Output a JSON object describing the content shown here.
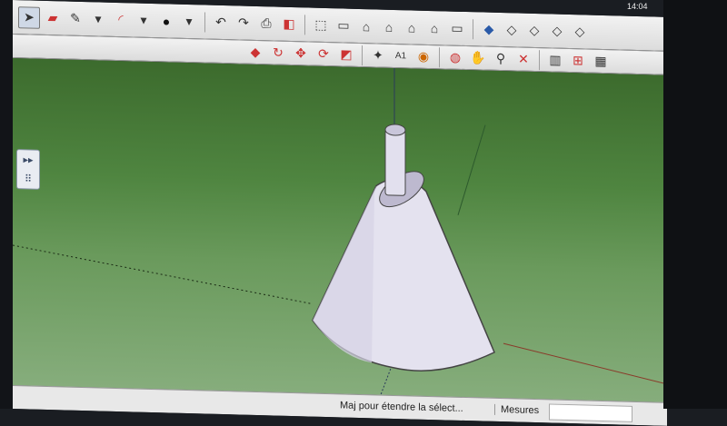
{
  "toolbar_row1": [
    "select-arrow-icon",
    "eraser-icon",
    "pencil-icon",
    "dropdown-icon",
    "arc-icon",
    "dropdown-icon",
    "circle-icon",
    "dropdown-icon",
    "undo-icon",
    "redo-icon",
    "print-icon",
    "model-info-icon",
    "iso-view-icon",
    "top-view-icon",
    "front-view-icon",
    "right-view-icon",
    "back-view-icon",
    "left-view-icon",
    "bottom-view-icon"
  ],
  "toolbar_row2": [
    "push-pull-icon",
    "follow-me-icon",
    "move-icon",
    "rotate-icon",
    "scale-icon",
    "tape-measure-icon",
    "text-icon",
    "paint-bucket-icon",
    "orbit-icon",
    "pan-icon",
    "zoom-icon",
    "zoom-extents-icon",
    "section-icon",
    "components-icon"
  ],
  "side_panel": {
    "expand": "▸▸",
    "grid": "⠿"
  },
  "status": {
    "hint": "Maj pour étendre la sélect...",
    "measure_label": "Mesures",
    "measure_value": "",
    "clock": "14:04"
  },
  "colors": {
    "sky": "#3c6b2d",
    "ground": "#86ad7c",
    "model": "#e6e4f2"
  }
}
